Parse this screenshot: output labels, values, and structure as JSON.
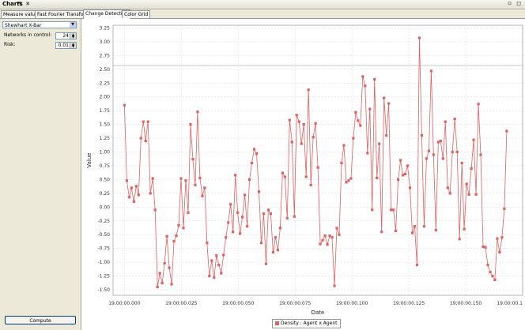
{
  "window": {
    "title": "Charts",
    "title_buttons": "⇱ ✕",
    "right_buttons": "▫ ◻"
  },
  "tabs": [
    {
      "label": "Measure values",
      "active": false
    },
    {
      "label": "Fast Fourier Transform",
      "active": false
    },
    {
      "label": "Change Detection",
      "active": true
    },
    {
      "label": "Color Grid",
      "active": false
    }
  ],
  "panel": {
    "method": "Shewhart X-Bar",
    "networks_label": "Networks in control:",
    "networks_value": "24",
    "risk_label": "Risk:",
    "risk_value": "0.01",
    "compute_label": "Compute"
  },
  "colors": {
    "series": "#e06060",
    "control_line": "#aaaaaa"
  },
  "chart_data": {
    "type": "line",
    "title": "",
    "xlabel": "Date",
    "ylabel": "Value",
    "ylim": [
      -1.6,
      3.3
    ],
    "yticks": [
      "3.25",
      "3.00",
      "2.75",
      "2.50",
      "2.25",
      "2.00",
      "1.75",
      "1.50",
      "1.25",
      "1.00",
      "0.75",
      "0.50",
      "0.25",
      "0.00",
      "-0.25",
      "-0.50",
      "-0.75",
      "-1.00",
      "-1.25",
      "-1.50"
    ],
    "ytick_values": [
      3.25,
      3.0,
      2.75,
      2.5,
      2.25,
      2.0,
      1.75,
      1.5,
      1.25,
      1.0,
      0.75,
      0.5,
      0.25,
      0.0,
      -0.25,
      -0.5,
      -0.75,
      -1.0,
      -1.25,
      -1.5
    ],
    "xticks": [
      "19:00:00.000",
      "19:00:00.025",
      "19:00:00.050",
      "19:00:00.075",
      "19:00:00.100",
      "19:00:00.125",
      "19:00:00.150",
      "19:00:00.1"
    ],
    "xtick_values": [
      0,
      25,
      50,
      75,
      100,
      125,
      150,
      175
    ],
    "xlim": [
      -5,
      175
    ],
    "control_limit": 2.57,
    "legend": "Density : Agent x Agent",
    "grid": true,
    "series": [
      {
        "values": [
          1.85,
          0.48,
          0.18,
          0.35,
          0.1,
          0.38,
          0.22,
          1.25,
          1.55,
          1.2,
          1.55,
          0.25,
          0.52,
          -0.05,
          -1.45,
          -1.2,
          -1.38,
          -1.02,
          -0.53,
          -1.1,
          -1.4,
          -0.62,
          -0.52,
          -0.33,
          0.52,
          -0.38,
          0.48,
          -0.1,
          1.5,
          0.87,
          0.4,
          1.73,
          0.53,
          0.2,
          0.35,
          -0.65,
          -1.25,
          -0.97,
          -1.28,
          -0.88,
          -1.05,
          -1.2,
          -0.87,
          -0.55,
          -0.28,
          0.05,
          -0.45,
          0.58,
          -0.1,
          -0.48,
          -0.18,
          0.22,
          -0.35,
          0.5,
          0.8,
          1.05,
          0.97,
          0.28,
          -0.65,
          -0.12,
          -1.03,
          -0.05,
          -0.12,
          -0.82,
          -0.55,
          -0.78,
          -0.38,
          0.62,
          0.55,
          -0.2,
          1.58,
          1.18,
          -0.17,
          1.67,
          1.55,
          1.15,
          1.5,
          0.55,
          2.13,
          0.4,
          1.27,
          1.52,
          0.72,
          -0.67,
          -0.6,
          -0.52,
          -0.68,
          -0.52,
          -0.55,
          -1.43,
          -0.38,
          -0.5,
          0.8,
          1.12,
          0.45,
          0.48,
          0.52,
          1.25,
          1.72,
          1.57,
          1.48,
          2.37,
          2.2,
          0.98,
          1.78,
          -0.05,
          2.32,
          0.53,
          1.15,
          -0.45,
          1.98,
          1.3,
          1.88,
          -0.05,
          -0.05,
          -0.43,
          0.5,
          0.85,
          0.58,
          0.6,
          0.75,
          0.35,
          -0.47,
          -0.35,
          -1.05,
          3.07,
          1.3,
          -0.35,
          0.88,
          1.02,
          2.47,
          0.95,
          -0.42,
          1.18,
          1.2,
          0.88,
          1.55,
          0.35,
          0.25,
          1.0,
          1.6,
          1.0,
          -0.58,
          0.8,
          -0.4,
          0.42,
          0.23,
          0.7,
          1.22,
          0.23,
          1.87,
          0.95,
          -0.72,
          -0.73,
          -1.05,
          -1.18,
          -1.25,
          -1.32,
          -0.57,
          -0.82,
          -0.55,
          -0.03,
          1.38
        ]
      }
    ]
  }
}
